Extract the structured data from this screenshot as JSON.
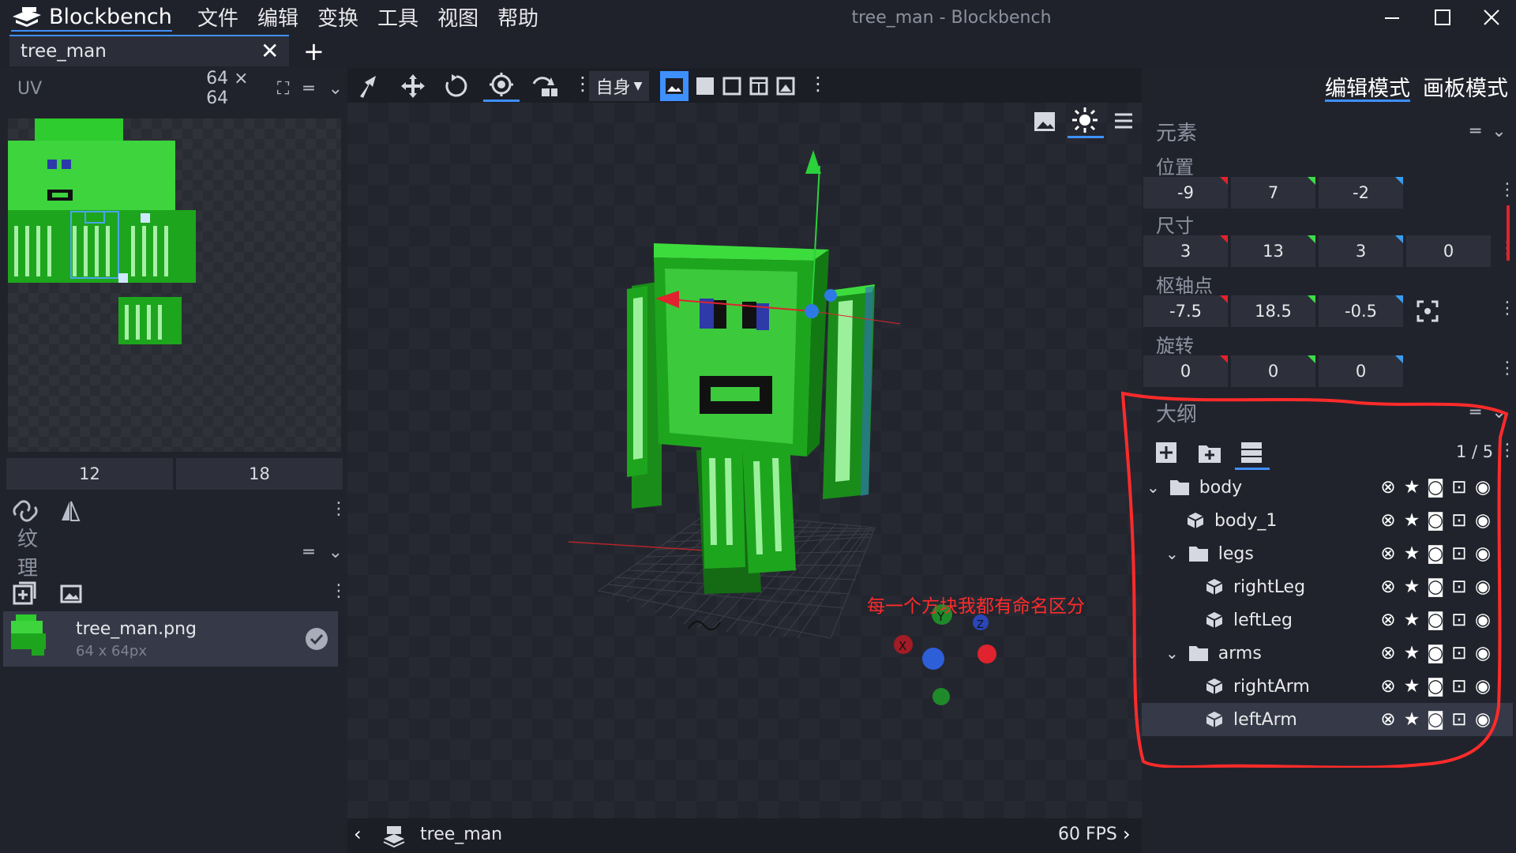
{
  "app": {
    "name": "Blockbench",
    "window_title": "tree_man - Blockbench"
  },
  "menu": [
    "文件",
    "编辑",
    "变换",
    "工具",
    "视图",
    "帮助"
  ],
  "tab": {
    "label": "tree_man"
  },
  "uv_panel": {
    "title": "UV",
    "size": "64 × 64",
    "size_w": "12",
    "size_h": "18"
  },
  "texture_panel": {
    "title": "纹理",
    "texture_name": "tree_man.png",
    "texture_dim": "64 x 64px"
  },
  "toolbar": {
    "space_select": "自身"
  },
  "viewport": {
    "fps": "60 FPS",
    "footer_model": "tree_man",
    "annotation": "每一个方块我都有命名区分"
  },
  "modes": {
    "edit": "编辑模式",
    "paint": "画板模式"
  },
  "element": {
    "title": "元素",
    "position_label": "位置",
    "position": [
      "-9",
      "7",
      "-2"
    ],
    "size_label": "尺寸",
    "size": [
      "3",
      "13",
      "3",
      "0"
    ],
    "pivot_label": "枢轴点",
    "pivot": [
      "-7.5",
      "18.5",
      "-0.5"
    ],
    "rotation_label": "旋转",
    "rotation": [
      "0",
      "0",
      "0"
    ]
  },
  "outliner": {
    "title": "大纲",
    "count": "1 / 5",
    "nodes": [
      {
        "name": "body",
        "type": "group"
      },
      {
        "name": "body_1",
        "type": "cube"
      },
      {
        "name": "legs",
        "type": "group"
      },
      {
        "name": "rightLeg",
        "type": "cube"
      },
      {
        "name": "leftLeg",
        "type": "cube"
      },
      {
        "name": "arms",
        "type": "group"
      },
      {
        "name": "rightArm",
        "type": "cube"
      },
      {
        "name": "leftArm",
        "type": "cube",
        "selected": true
      }
    ]
  },
  "colors": {
    "accent": "#3e90ff",
    "annotation": "#ff2b2b",
    "model_green": "#2fb532",
    "axis_x": "#e0232e",
    "axis_y": "#3bdc47",
    "axis_z": "#3a9cf0"
  }
}
